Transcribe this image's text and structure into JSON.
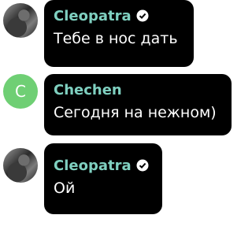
{
  "messages": [
    {
      "author": "Cleopatra",
      "verified": true,
      "text": "Тебе в нос дать"
    },
    {
      "author": "Chechen",
      "avatar_letter": "C",
      "text": "Сегодня на нежном)"
    },
    {
      "author": "Cleopatra",
      "verified": true,
      "text": "Ой"
    }
  ],
  "colors": {
    "name": "#7fd0c0",
    "avatar_green": "#6fcf74",
    "bubble": "#000000"
  }
}
